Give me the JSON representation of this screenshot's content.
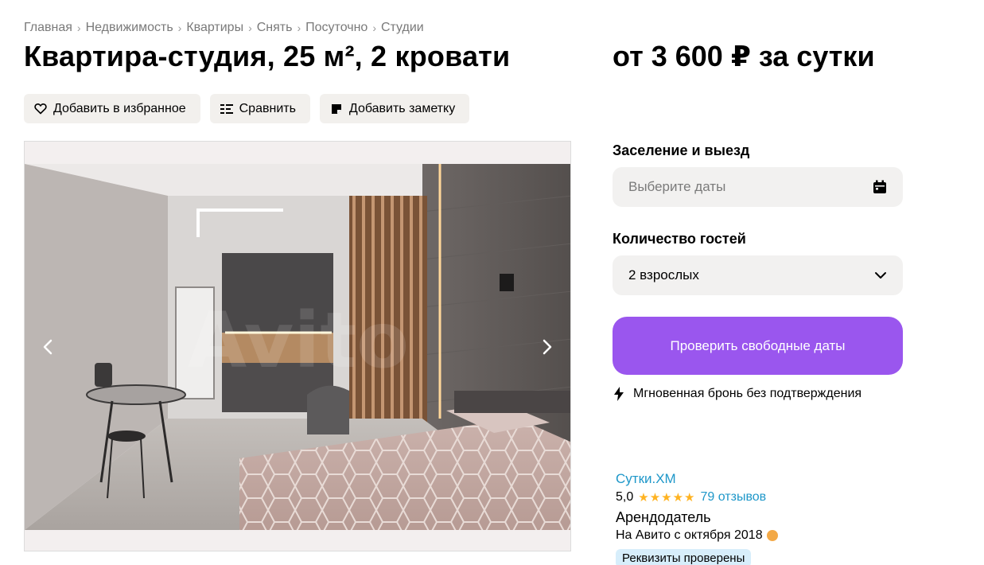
{
  "breadcrumb": [
    "Главная",
    "Недвижимость",
    "Квартиры",
    "Снять",
    "Посуточно",
    "Студии"
  ],
  "listing": {
    "title": "Квартира-студия, 25 м², 2 кровати",
    "price": "от 3 600 ₽ за сутки"
  },
  "actions": {
    "favorite": "Добавить в избранное",
    "compare": "Сравнить",
    "note": "Добавить заметку"
  },
  "booking": {
    "dates_label": "Заселение и выезд",
    "dates_placeholder": "Выберите даты",
    "guests_label": "Количество гостей",
    "guests_value": "2 взрослых",
    "check_button": "Проверить свободные даты",
    "instant_text": "Мгновенная бронь без подтверждения"
  },
  "seller": {
    "name": "Сутки.ХМ",
    "rating": "5,0",
    "stars": "★★★★★",
    "reviews": "79 отзывов",
    "type": "Арендодатель",
    "since": "На Авито с октября 2018",
    "verified": "Реквизиты проверены"
  },
  "colors": {
    "accent": "#9a56ee",
    "link": "#1e97c9",
    "star": "#ffb321",
    "chip_bg": "#f2f0ed"
  },
  "icons": [
    "heart-icon",
    "compare-icon",
    "note-icon",
    "calendar-icon",
    "chevron-down-icon",
    "lightning-icon",
    "chevron-left-icon",
    "chevron-right-icon",
    "medal-icon"
  ]
}
